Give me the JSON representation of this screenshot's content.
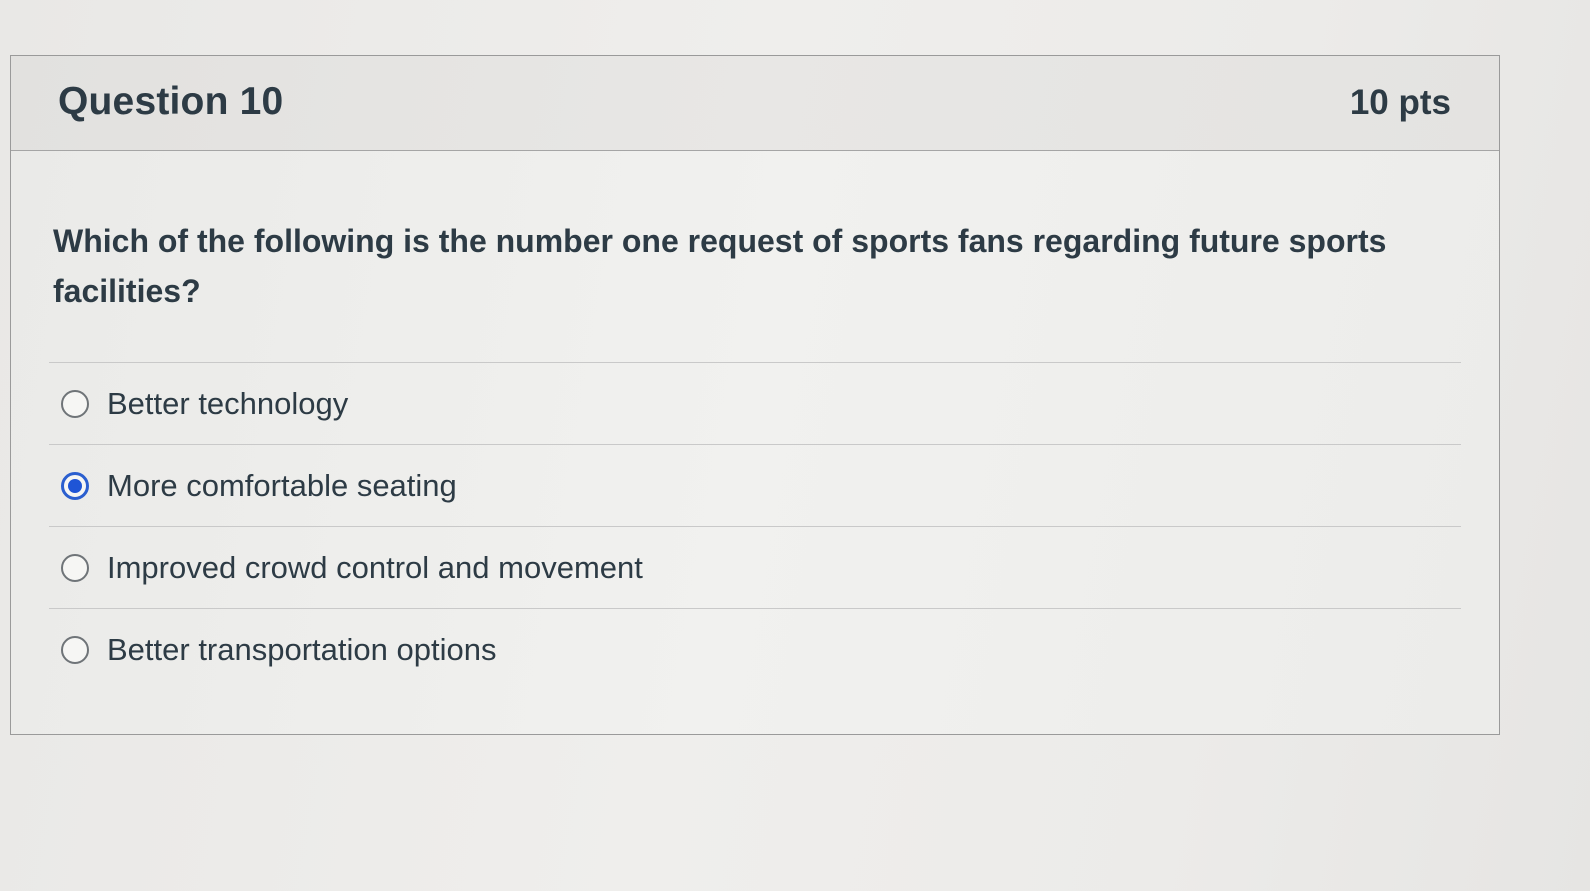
{
  "question": {
    "title": "Question 10",
    "points": "10 pts",
    "text": "Which of the following is the number one request of sports fans regarding future sports facilities?",
    "answers": [
      {
        "label": "Better technology",
        "selected": false
      },
      {
        "label": "More comfortable seating",
        "selected": true
      },
      {
        "label": "Improved crowd control and movement",
        "selected": false
      },
      {
        "label": "Better transportation options",
        "selected": false
      }
    ]
  },
  "colors": {
    "text": "#2d3b45",
    "selected_radio": "#1f55d6",
    "border": "#9a9a9a"
  }
}
